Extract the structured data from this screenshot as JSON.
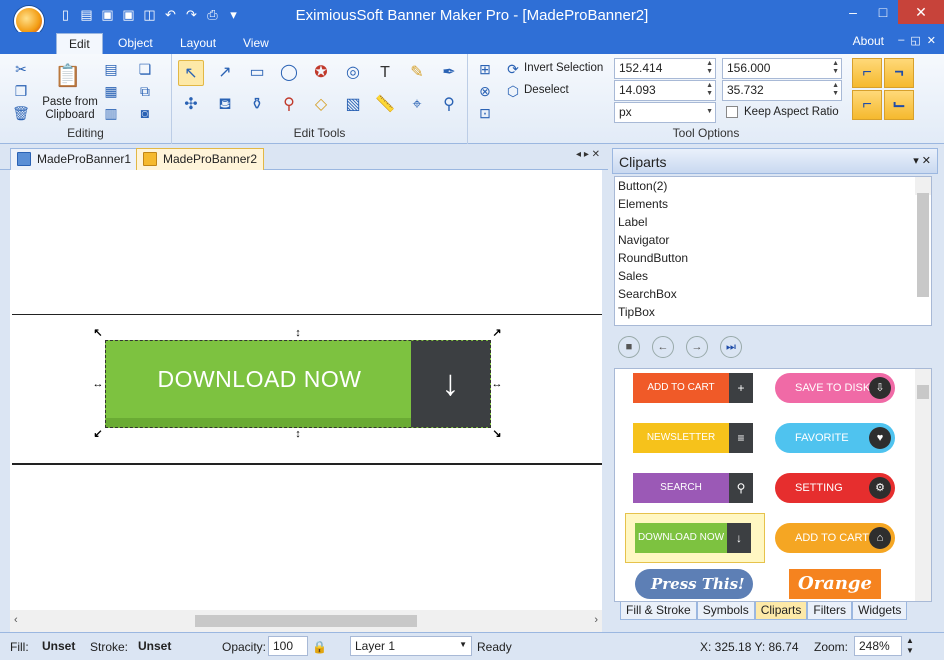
{
  "window": {
    "title": "EximiousSoft Banner Maker Pro - [MadeProBanner2]"
  },
  "ribbon_tabs": [
    "Edit",
    "Object",
    "Layout",
    "View"
  ],
  "about": "About",
  "editing": {
    "paste_label": "Paste from Clipboard",
    "group_label": "Editing"
  },
  "edit_tools": {
    "group_label": "Edit Tools"
  },
  "tool_options": {
    "invert_selection": "Invert Selection",
    "deselect": "Deselect",
    "x": "152.414",
    "y": "14.093",
    "w": "156.000",
    "h": "35.732",
    "unit": "px",
    "keep_aspect": "Keep Aspect Ratio",
    "group_label": "Tool Options"
  },
  "doc_tabs": [
    "MadeProBanner1",
    "MadeProBanner2"
  ],
  "banner": {
    "text": "DOWNLOAD NOW",
    "icon": "↓",
    "color": "#7dc240"
  },
  "cliparts": {
    "title": "Cliparts",
    "list": [
      "Button(2)",
      "Elements",
      "Label",
      "Navigator",
      "RoundButton",
      "Sales",
      "SearchBox",
      "TipBox"
    ],
    "gallery": {
      "add_to_cart_rect": "ADD TO CART",
      "save_to_disk": "SAVE TO DISK",
      "newsletter": "NEWSLETTER",
      "favorite": "FAVORITE",
      "search": "SEARCH",
      "setting": "SETTING",
      "download_now": "DOWNLOAD NOW",
      "add_to_cart_pill": "ADD TO CART",
      "press_this": "Press This!",
      "orange": "Orange"
    }
  },
  "panel_tabs": [
    "Fill & Stroke",
    "Symbols",
    "Cliparts",
    "Filters",
    "Widgets"
  ],
  "status": {
    "fill_label": "Fill:",
    "fill_value": "Unset",
    "stroke_label": "Stroke:",
    "stroke_value": "Unset",
    "opacity_label": "Opacity:",
    "opacity_value": "100",
    "layer": "Layer 1",
    "ready": "Ready",
    "coords": "X:  325.18 Y:   86.74",
    "zoom_label": "Zoom:",
    "zoom_value": "248%"
  }
}
